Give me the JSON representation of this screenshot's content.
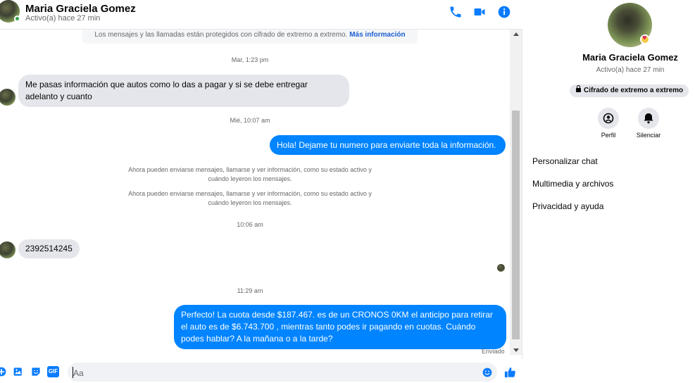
{
  "header": {
    "name": "Maria Graciela Gomez",
    "status": "Activo(a) hace 27 min",
    "call_icon": "phone-icon",
    "video_icon": "video-camera-icon",
    "info_icon": "info-icon"
  },
  "encryption_note": {
    "text": "Los mensajes y las llamadas están protegidos con cifrado de extremo a extremo.",
    "link": "Más información"
  },
  "messages": [
    {
      "timestamp": "Mar, 1:23 pm"
    },
    {
      "incoming": "Me pasas información que autos como lo das a pagar y si se debe entregar adelanto y cuanto"
    },
    {
      "timestamp": "Mié, 10:07 am"
    },
    {
      "outgoing": "Hola! Dejame tu numero  para enviarte toda la información."
    },
    {
      "system": "Ahora pueden enviarse mensajes, llamarse y ver información, como su estado activo y cuándo leyeron los mensajes."
    },
    {
      "system": "Ahora pueden enviarse mensajes, llamarse y ver información, como su estado activo y cuándo leyeron los mensajes."
    },
    {
      "timestamp": "10:06 am"
    },
    {
      "incoming": "2392514245"
    },
    {
      "timestamp": "11:29 am"
    },
    {
      "outgoing": "Perfecto! La cuota desde $187.467. es de un CRONOS 0KM el anticipo para retirar el auto es de $6.743.700 , mientras tanto podes ir pagando en cuotas. Cuándo podes hablar? A la mañana o a la tarde?"
    }
  ],
  "sent_label": "Enviado",
  "composer": {
    "placeholder": "Aa",
    "icons": [
      "plus-circle-icon",
      "photo-icon",
      "sticker-icon",
      "gif-icon",
      "emoji-icon",
      "thumbs-up-icon"
    ],
    "gif_label": "GIF"
  },
  "side_panel": {
    "name": "Maria Graciela Gomez",
    "status": "Activo(a) hace 27 min",
    "encryption_pill": "Cifrado de extremo a extremo",
    "actions": [
      {
        "label": "Perfil",
        "icon": "profile-icon"
      },
      {
        "label": "Silenciar",
        "icon": "bell-icon"
      }
    ],
    "menu": [
      "Personalizar chat",
      "Multimedia y archivos",
      "Privacidad y ayuda"
    ]
  },
  "colors": {
    "accent": "#0084ff",
    "incoming_bubble": "#e4e6eb",
    "online": "#31a24c",
    "icon_blue": "#0a7cff"
  }
}
